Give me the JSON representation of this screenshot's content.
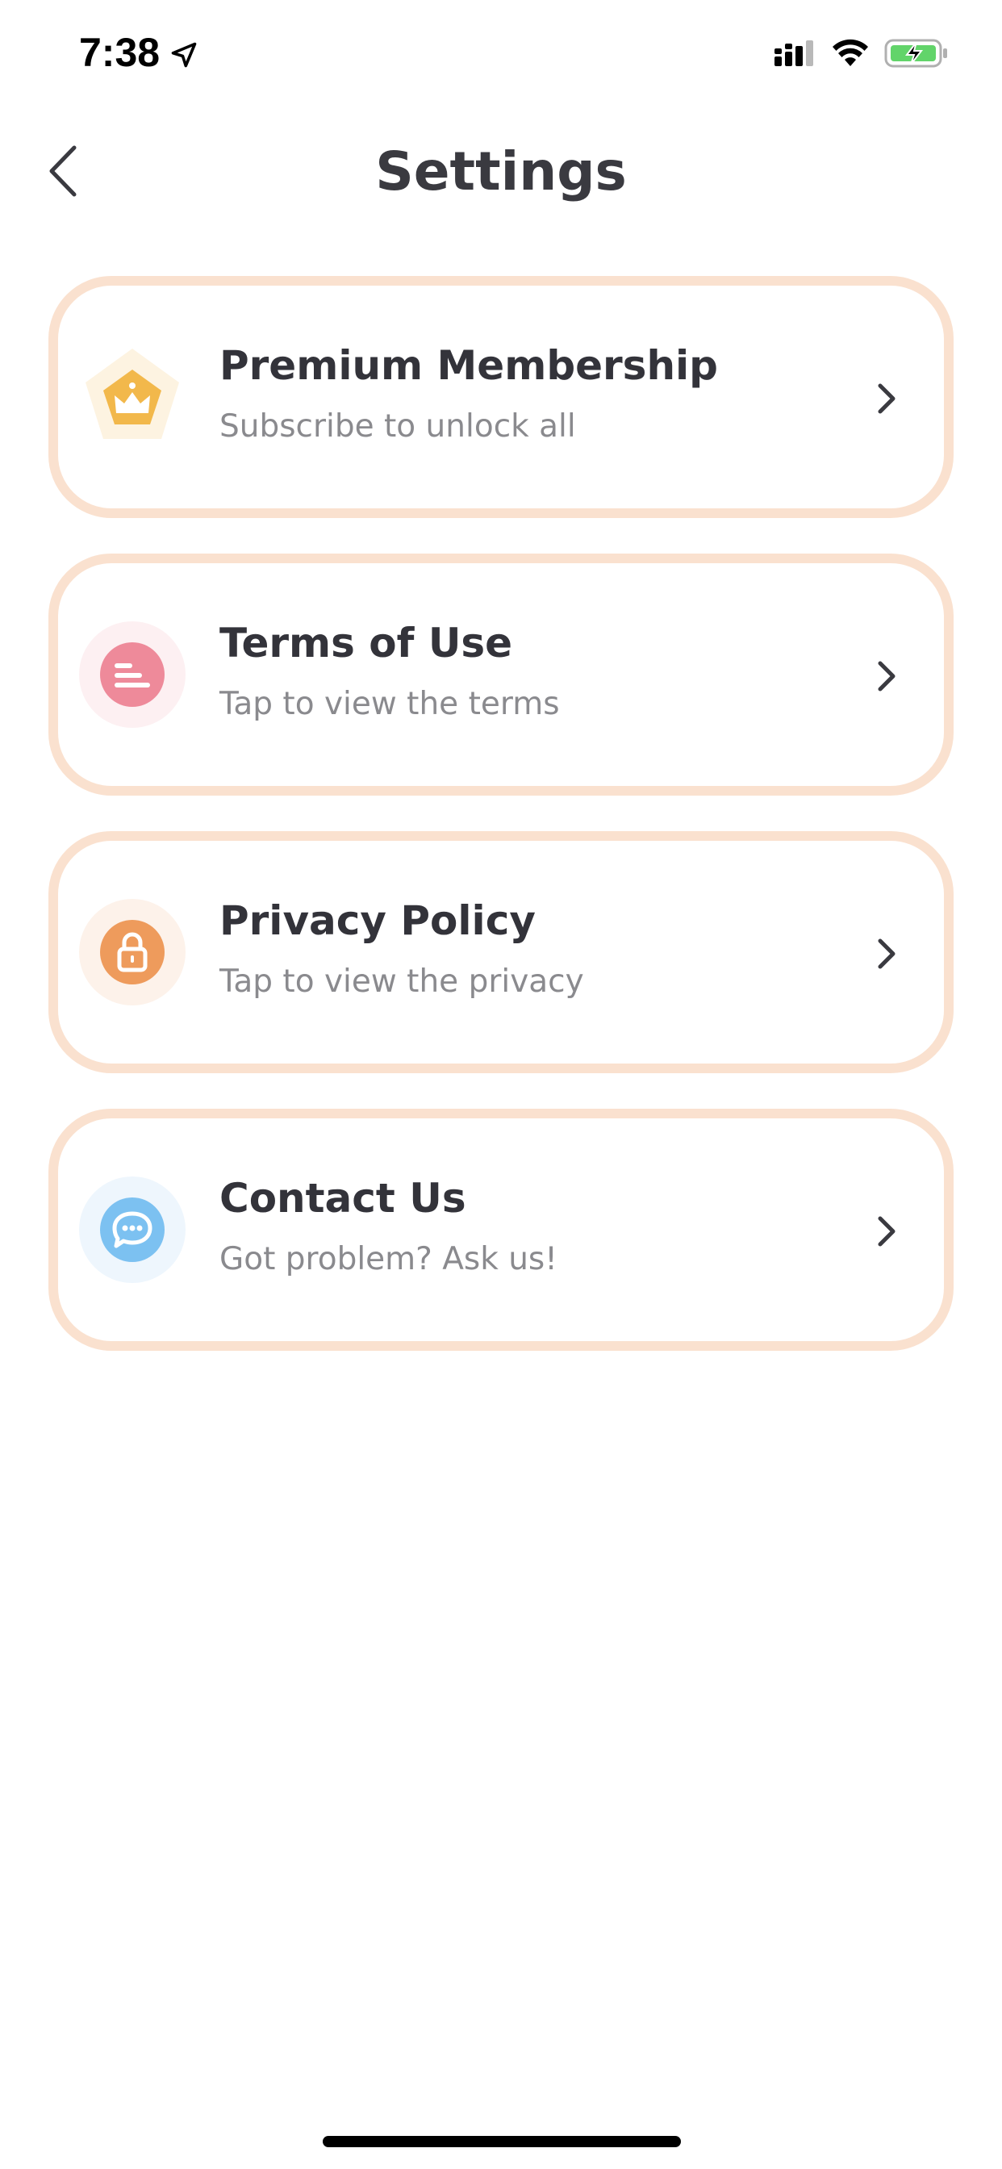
{
  "status_bar": {
    "time": "7:38"
  },
  "header": {
    "title": "Settings"
  },
  "items": [
    {
      "title": "Premium Membership",
      "subtitle": "Subscribe to unlock all",
      "icon": "crown-icon",
      "color": "#f2b84b"
    },
    {
      "title": "Terms of Use",
      "subtitle": "Tap to view the terms",
      "icon": "document-lines-icon",
      "color": "#ee8a9a"
    },
    {
      "title": "Privacy Policy",
      "subtitle": "Tap to view the privacy",
      "icon": "lock-icon",
      "color": "#ee9b5c"
    },
    {
      "title": "Contact Us",
      "subtitle": "Got problem? Ask us!",
      "icon": "chat-bubble-icon",
      "color": "#7cc1f1"
    }
  ],
  "colors": {
    "card_border": "#fae1cf",
    "title_text": "#33333a",
    "subtitle_text": "#8a8a8e"
  }
}
